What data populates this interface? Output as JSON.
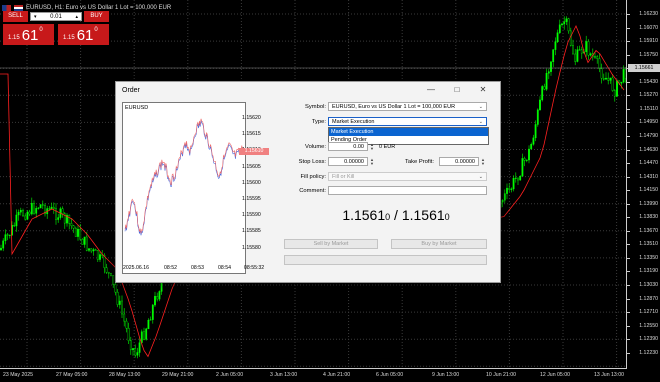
{
  "chart_window": {
    "title": "EURUSD, H1:  Euro vs US Dollar 1 Lot = 100,000 EUR",
    "price_ticks": [
      "1.16230",
      "1.16070",
      "1.15910",
      "1.15750",
      "1.15590",
      "1.15430",
      "1.15270",
      "1.15110",
      "1.14950",
      "1.14790",
      "1.14630",
      "1.14470",
      "1.14310",
      "1.14150",
      "1.13990",
      "1.13830",
      "1.13670",
      "1.13510",
      "1.13350",
      "1.13190",
      "1.13030",
      "1.12870",
      "1.12710",
      "1.12550",
      "1.12390",
      "1.12230"
    ],
    "current_price": "1.15661",
    "time_labels": [
      "23 May 2025",
      "27 May 05:00",
      "28 May 13:00",
      "29 May 21:00",
      "2 Jun 05:00",
      "3 Jun 13:00",
      "4 Jun 21:00",
      "6 Jun 05:00",
      "9 Jun 13:00",
      "10 Jun 21:00",
      "12 Jun 05:00",
      "13 Jun 13:00"
    ],
    "colors": {
      "bull": "#00ff00",
      "bear": "#00ff00",
      "ma": "#ff2020",
      "grid": "#444444"
    }
  },
  "one_click": {
    "sell_label": "SELL",
    "buy_label": "BUY",
    "volume": "0.01",
    "sell_price_small": "1.15",
    "sell_price_big": "61",
    "sell_price_sup": "0",
    "buy_price_small": "1.15",
    "buy_price_big": "61",
    "buy_price_sup": "0",
    "color": "#c7191a"
  },
  "dialog": {
    "title": "Order",
    "mini_chart": {
      "symbol": "EURUSD",
      "ticks": [
        "1.15620",
        "1.15615",
        "1.15610",
        "1.15605",
        "1.15600",
        "1.15595",
        "1.15590",
        "1.15585",
        "1.15580"
      ],
      "current": "1.15610",
      "time_labels": [
        "2025.06.16",
        "08:52",
        "08:53",
        "08:54",
        "08:55:32"
      ]
    },
    "labels": {
      "symbol": "Symbol:",
      "type": "Type:",
      "volume": "Volume:",
      "stop_loss": "Stop Loss:",
      "take_profit": "Take Profit:",
      "fill_policy": "Fill policy:",
      "comment": "Comment:"
    },
    "symbol_value": "EURUSD, Euro vs US Dollar 1 Lot = 100,000 EUR",
    "type_value": "Market Execution",
    "type_options": [
      "Market Execution",
      "Pending Order"
    ],
    "volume_value": "0.00",
    "volume_unit": "0 EUR",
    "stop_loss_value": "0.00000",
    "take_profit_value": "0.00000",
    "fill_policy_value": "Fill or Kill",
    "comment_value": "",
    "bid_main": "1.1561",
    "bid_small": "0",
    "separator": " / ",
    "ask_main": "1.1561",
    "ask_small": "0",
    "sell_button": "Sell by Market",
    "buy_button": "Buy by Market"
  }
}
